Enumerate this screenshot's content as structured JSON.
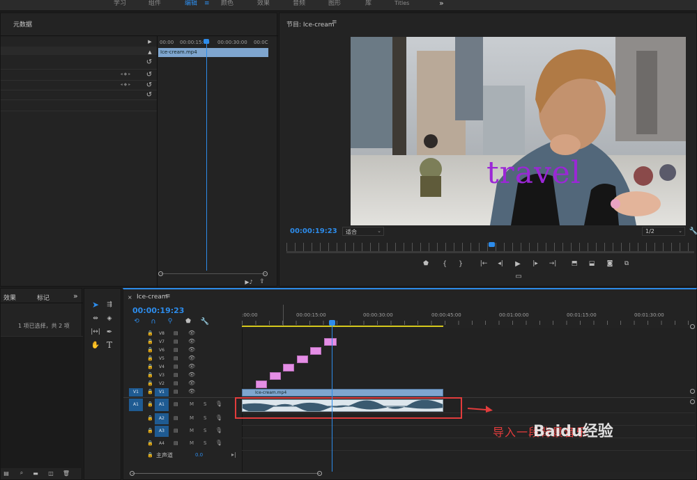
{
  "workspaces": [
    "学习",
    "组件",
    "编辑",
    "颜色",
    "效果",
    "音频",
    "图形",
    "库",
    "Titles"
  ],
  "active_workspace": "编辑",
  "effect_controls": {
    "title": "元数据",
    "times": [
      "00:00",
      "00:00:15:00",
      "00:00:30:00",
      "00:0C"
    ],
    "clip_name": "Ice-cream.mp4"
  },
  "program_monitor": {
    "title": "节目: Ice-cream",
    "timecode": "00:00:19:23",
    "fit": "适合",
    "resolution": "1/2",
    "overlay_text": "travel"
  },
  "project_panel": {
    "tabs": [
      "效果",
      "标记"
    ],
    "selection_info": "1 项已选择，共 2 项"
  },
  "timeline": {
    "title": "Ice-cream",
    "timecode": "00:00:19:23",
    "ruler": [
      ":00:00",
      "00:00:15:00",
      "00:00:30:00",
      "00:00:45:00",
      "00:01:00:00",
      "00:01:15:00",
      "00:01:30:00"
    ],
    "video_tracks": [
      "V8",
      "V7",
      "V6",
      "V5",
      "V4",
      "V3",
      "V2",
      "V1"
    ],
    "audio_tracks": [
      "A1",
      "A2",
      "A3",
      "A4"
    ],
    "source_v": "V1",
    "source_a": "A1",
    "track_m": "M",
    "track_s": "S",
    "master_label": "主声道",
    "master_value": "0.0",
    "video_clip": "Ice-cream.mp4",
    "annotation": "导入一段背景音乐",
    "watermark": "Baidu经验"
  },
  "colors": {
    "accent": "#2d8ceb",
    "pink_clip": "#e58ee6",
    "annotation": "#e23c3c",
    "overlay_text": "#9b27d6"
  }
}
